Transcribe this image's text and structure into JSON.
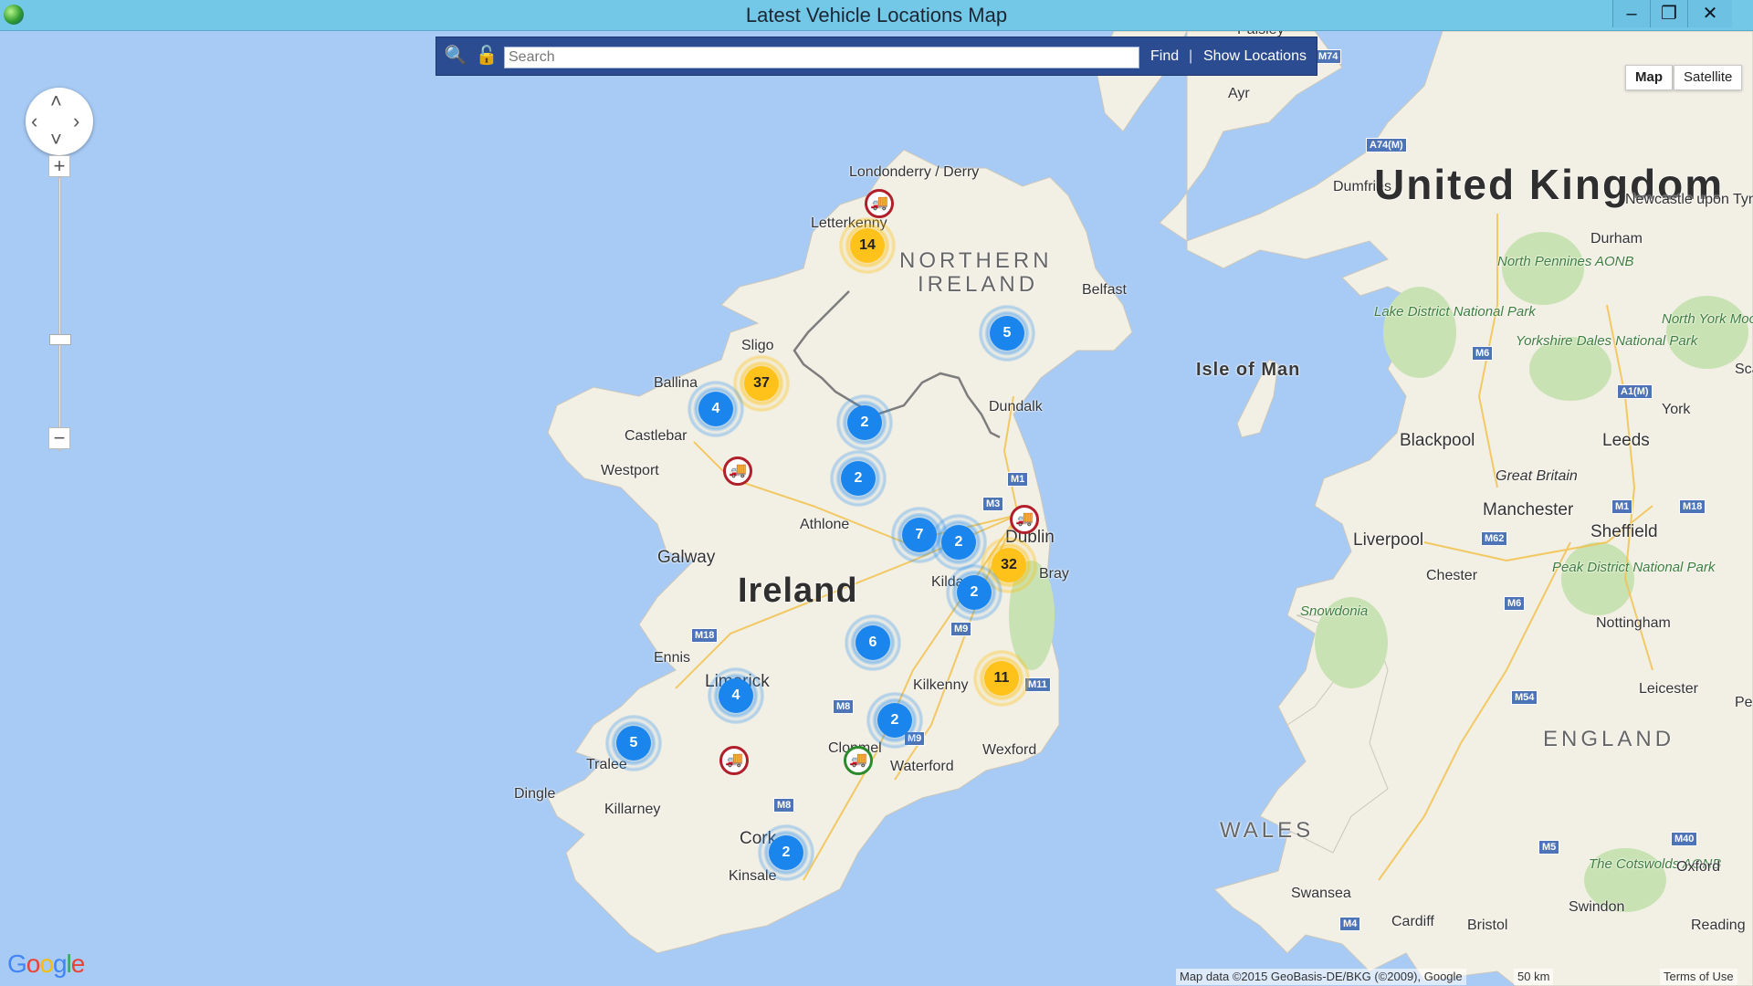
{
  "window": {
    "title": "Latest Vehicle Locations Map",
    "minimize_glyph": "–",
    "restore_glyph": "❐",
    "close_glyph": "✕"
  },
  "search": {
    "placeholder": "Search",
    "value": "",
    "find_label": "Find",
    "separator": "|",
    "show_locations_label": "Show Locations",
    "search_icon": "magnifier-icon",
    "lock_icon": "lock-icon"
  },
  "map_type": {
    "map_label": "Map",
    "satellite_label": "Satellite",
    "selected": "Map"
  },
  "attribution": {
    "google": "Google",
    "data": "Map data ©2015 GeoBasis-DE/BKG (©2009), Google",
    "scale": "50 km",
    "terms": "Terms of Use"
  },
  "labels": {
    "ireland": "Ireland",
    "uk": "United Kingdom",
    "northern_ireland_1": "NORTHERN",
    "northern_ireland_2": "IRELAND",
    "wales": "WALES",
    "england": "ENGLAND",
    "isle_of_man": "Isle of Man",
    "paisley": "Paisley",
    "ayr": "Ayr",
    "dumfries": "Dumfries",
    "newcastle": "Newcastle upon Tyne",
    "durham": "Durham",
    "north_pennines": "North Pennines AONB",
    "lake_district": "Lake District National Park",
    "north_york_moors": "North York Moors National Park",
    "yorkshire_dales": "Yorkshire Dales National Park",
    "scar": "Scar",
    "york": "York",
    "blackpool": "Blackpool",
    "leeds": "Leeds",
    "great_britain": "Great Britain",
    "manchester": "Manchester",
    "liverpool": "Liverpool",
    "sheffield": "Sheffield",
    "chester": "Chester",
    "peak_district": "Peak District National Park",
    "snowdonia": "Snowdonia",
    "nottingham": "Nottingham",
    "leicester": "Leicester",
    "pe": "Pe",
    "cotswolds": "The Cotswolds AONB",
    "oxford": "Oxford",
    "swindon": "Swindon",
    "reading": "Reading",
    "bristol": "Bristol",
    "cardiff": "Cardiff",
    "swansea": "Swansea",
    "londonderry": "Londonderry / Derry",
    "letterkenny": "Letterkenny",
    "belfast": "Belfast",
    "sligo": "Sligo",
    "ballina": "Ballina",
    "castlebar": "Castlebar",
    "westport": "Westport",
    "dundalk": "Dundalk",
    "athlone": "Athlone",
    "galway": "Galway",
    "dublin": "Dublin",
    "bray": "Bray",
    "kildare": "Kilda",
    "ennis": "Ennis",
    "limerick": "Limerick",
    "kilkenny": "Kilkenny",
    "wexford": "Wexford",
    "tralee": "Tralee",
    "clonmel": "Clonmel",
    "waterford": "Waterford",
    "dingle": "Dingle",
    "killarney": "Killarney",
    "cork": "Cork",
    "kinsale": "Kinsale"
  },
  "roads": [
    "M74",
    "A74(M)",
    "M6",
    "A1(M)",
    "M62",
    "M1",
    "M18",
    "M6",
    "M54",
    "M5",
    "M40",
    "M4",
    "M1",
    "M3",
    "M18",
    "M9",
    "M8",
    "M9",
    "M11",
    "M8"
  ],
  "clusters": [
    {
      "count": "14",
      "color": "yellow"
    },
    {
      "count": "5",
      "color": "blue"
    },
    {
      "count": "37",
      "color": "yellow"
    },
    {
      "count": "4",
      "color": "blue"
    },
    {
      "count": "2",
      "color": "blue"
    },
    {
      "count": "2",
      "color": "blue"
    },
    {
      "count": "7",
      "color": "blue"
    },
    {
      "count": "2",
      "color": "blue"
    },
    {
      "count": "32",
      "color": "yellow"
    },
    {
      "count": "2",
      "color": "blue"
    },
    {
      "count": "6",
      "color": "blue"
    },
    {
      "count": "11",
      "color": "yellow"
    },
    {
      "count": "4",
      "color": "blue"
    },
    {
      "count": "2",
      "color": "blue"
    },
    {
      "count": "5",
      "color": "blue"
    },
    {
      "count": "2",
      "color": "blue"
    }
  ],
  "vehicles": [
    {
      "status": "alert",
      "icon": "truck-icon"
    },
    {
      "status": "alert",
      "icon": "truck-icon"
    },
    {
      "status": "alert",
      "icon": "truck-icon"
    },
    {
      "status": "alert",
      "icon": "truck-icon"
    },
    {
      "status": "ok",
      "icon": "truck-icon"
    }
  ],
  "colors": {
    "sea": "#a8cbf5",
    "land": "#f2efe4",
    "titlebar": "#74c8e7",
    "searchbar": "#2b4c91",
    "cluster_blue": "#1b85ee",
    "cluster_yellow": "#ffc21a",
    "vehicle_alert": "#b01f2a",
    "vehicle_ok": "#2b8a2b"
  }
}
